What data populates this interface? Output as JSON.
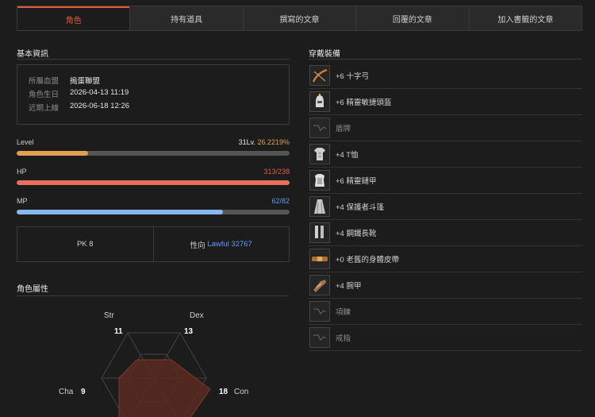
{
  "tabs": [
    {
      "label": "角色",
      "active": true
    },
    {
      "label": "持有道具",
      "active": false
    },
    {
      "label": "撰寫的文章",
      "active": false
    },
    {
      "label": "回覆的文章",
      "active": false
    },
    {
      "label": "加入書籤的文章",
      "active": false
    }
  ],
  "basic_info": {
    "title": "基本資訊",
    "rows": [
      {
        "key": "所屬血盟",
        "value": "搗蛋聯盟"
      },
      {
        "key": "角色生日",
        "value": "2026-04-13 11:19"
      },
      {
        "key": "近期上線",
        "value": "2026-06-18 12:26"
      }
    ]
  },
  "stats": {
    "level": {
      "label": "Level",
      "value_main": "31Lv.",
      "value_sub": "26.2219%",
      "fill": 0.262,
      "color": "#e0a050"
    },
    "hp": {
      "label": "HP",
      "value": "313/238",
      "fill": 1.0,
      "color": "#e8705a"
    },
    "mp": {
      "label": "MP",
      "value": "62/82",
      "fill": 0.756,
      "color": "#8ab8f0"
    }
  },
  "pk": {
    "pk_text": "PK 8",
    "alignment_label": "性向",
    "alignment_value": "Lawful 32767"
  },
  "attributes": {
    "title": "角色屬性",
    "items": [
      {
        "name": "Str",
        "value": "11"
      },
      {
        "name": "Dex",
        "value": "13"
      },
      {
        "name": "Con",
        "value": "18"
      },
      {
        "name": "Cha",
        "value": "9"
      }
    ]
  },
  "equipment": {
    "title": "穿戴裝備",
    "items": [
      {
        "name": "+6 十字弓",
        "icon": "crossbow-icon",
        "equipped": true
      },
      {
        "name": "+6 精靈敏捷頭盔",
        "icon": "helmet-icon",
        "equipped": true
      },
      {
        "name": "盾牌",
        "icon": "empty-slot-icon",
        "equipped": false
      },
      {
        "name": "+4 T恤",
        "icon": "tshirt-icon",
        "equipped": true
      },
      {
        "name": "+6 精靈鏈甲",
        "icon": "chainmail-icon",
        "equipped": true
      },
      {
        "name": "+4 保護者斗篷",
        "icon": "cloak-icon",
        "equipped": true
      },
      {
        "name": "+4 鋼鐵長靴",
        "icon": "boots-icon",
        "equipped": true
      },
      {
        "name": "+0 老舊的身體皮帶",
        "icon": "belt-icon",
        "equipped": true
      },
      {
        "name": "+4 腕甲",
        "icon": "bracer-icon",
        "equipped": true
      },
      {
        "name": "項鍊",
        "icon": "empty-slot-icon",
        "equipped": false
      },
      {
        "name": "戒指",
        "icon": "empty-slot-icon",
        "equipped": false
      }
    ]
  },
  "colors": {
    "accent": "#e05a3a",
    "link": "#5a9bff"
  }
}
